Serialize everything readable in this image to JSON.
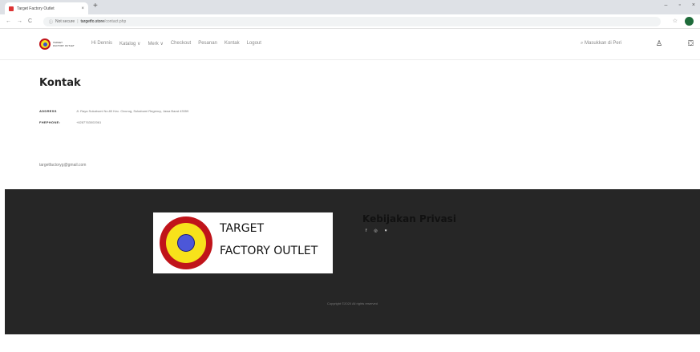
{
  "browser": {
    "tab_title": "Target Factory Outlet",
    "tab_close": "×",
    "new_tab": "+",
    "window_controls": [
      "–",
      "▫",
      "×"
    ],
    "nav_back": "←",
    "nav_forward": "→",
    "nav_reload": "C",
    "lock_icon": "ⓘ",
    "insecure_label": "Not secure",
    "url_host": "targetfo.store",
    "url_path": "/contact.php",
    "star_icon": "☆"
  },
  "header": {
    "logo_text_line1": "TARGET",
    "logo_text_line2": "FACTORY OUTLET",
    "menu": [
      "Hi Dennis",
      "Katalog ∨",
      "Merk ∨",
      "Checkout",
      "Pesanan",
      "Kontak",
      "Logout"
    ],
    "search_label": "Masukkan di Peri",
    "search_icon": "⌕",
    "user_icon": "♙",
    "bag_icon": "⛋"
  },
  "contact": {
    "title": "Kontak",
    "address_label": "ADDRESS",
    "address_value": "Jl. Raya Sukabumi No.80 Kec. Cicurug, Sukabumi Regency, Jawa Barat 43359",
    "phone_label": "FHEPHONE:",
    "phone_value": "+6287763002061",
    "email": "targetfactoryg@gmail.com"
  },
  "footer": {
    "logo_line1": "TARGET",
    "logo_line2": "FACTORY OUTLET",
    "policy_title": "Kebijakan Privasi",
    "social": [
      "f",
      "◎",
      "♥"
    ],
    "copyright": "Copyright ©2020 All rights reserved"
  },
  "colors": {
    "footer_bg": "#262626",
    "logo_red": "#c0141a",
    "logo_yellow": "#f7e21b",
    "logo_blue": "#4c57d8"
  }
}
